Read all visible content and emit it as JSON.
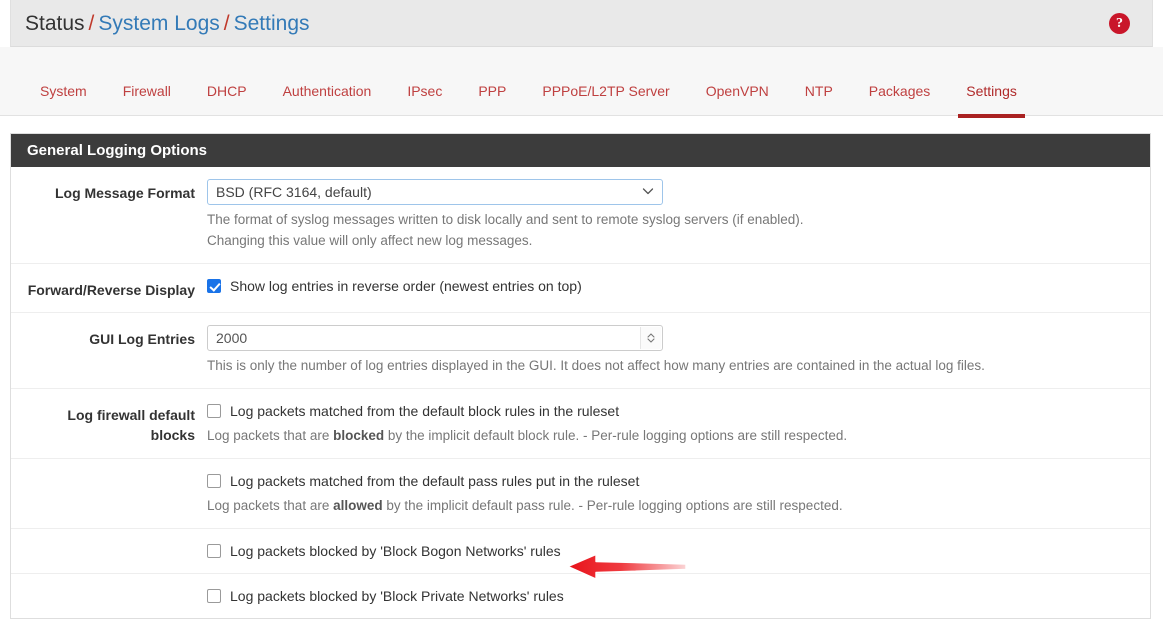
{
  "breadcrumb": {
    "root": "Status",
    "sep": "/",
    "section": "System Logs",
    "page": "Settings"
  },
  "help_button": {
    "glyph": "?",
    "color": "#c9162a"
  },
  "tabs": [
    {
      "label": "System",
      "active": false
    },
    {
      "label": "Firewall",
      "active": false
    },
    {
      "label": "DHCP",
      "active": false
    },
    {
      "label": "Authentication",
      "active": false
    },
    {
      "label": "IPsec",
      "active": false
    },
    {
      "label": "PPP",
      "active": false
    },
    {
      "label": "PPPoE/L2TP Server",
      "active": false
    },
    {
      "label": "OpenVPN",
      "active": false
    },
    {
      "label": "NTP",
      "active": false
    },
    {
      "label": "Packages",
      "active": false
    },
    {
      "label": "Settings",
      "active": true
    }
  ],
  "panel": {
    "title": "General Logging Options"
  },
  "rows": {
    "log_message_format": {
      "label": "Log Message Format",
      "selected": "BSD (RFC 3164, default)",
      "help_line1": "The format of syslog messages written to disk locally and sent to remote syslog servers (if enabled).",
      "help_line2": "Changing this value will only affect new log messages."
    },
    "forward_reverse": {
      "label": "Forward/Reverse Display",
      "checkbox_label": "Show log entries in reverse order (newest entries on top)",
      "checked": true
    },
    "gui_log_entries": {
      "label": "GUI Log Entries",
      "value": "2000",
      "help": "This is only the number of log entries displayed in the GUI. It does not affect how many entries are contained in the actual log files."
    },
    "default_blocks": {
      "label_line1": "Log firewall default",
      "label_line2": "blocks",
      "checkbox_label": "Log packets matched from the default block rules in the ruleset",
      "checked": false,
      "help_pre": "Log packets that are ",
      "help_bold": "blocked",
      "help_post": " by the implicit default block rule. - Per-rule logging options are still respected."
    },
    "default_pass": {
      "checkbox_label": "Log packets matched from the default pass rules put in the ruleset",
      "checked": false,
      "help_pre": "Log packets that are ",
      "help_bold": "allowed",
      "help_post": " by the implicit default pass rule. - Per-rule logging options are still respected."
    },
    "block_bogon": {
      "checkbox_label": "Log packets blocked by 'Block Bogon Networks' rules",
      "checked": false
    },
    "block_private": {
      "checkbox_label": "Log packets blocked by 'Block Private Networks' rules",
      "checked": false
    }
  },
  "annotation": {
    "arrow_color": "#e8121a",
    "points_to": "Log packets blocked by 'Block Private Networks' rules"
  }
}
